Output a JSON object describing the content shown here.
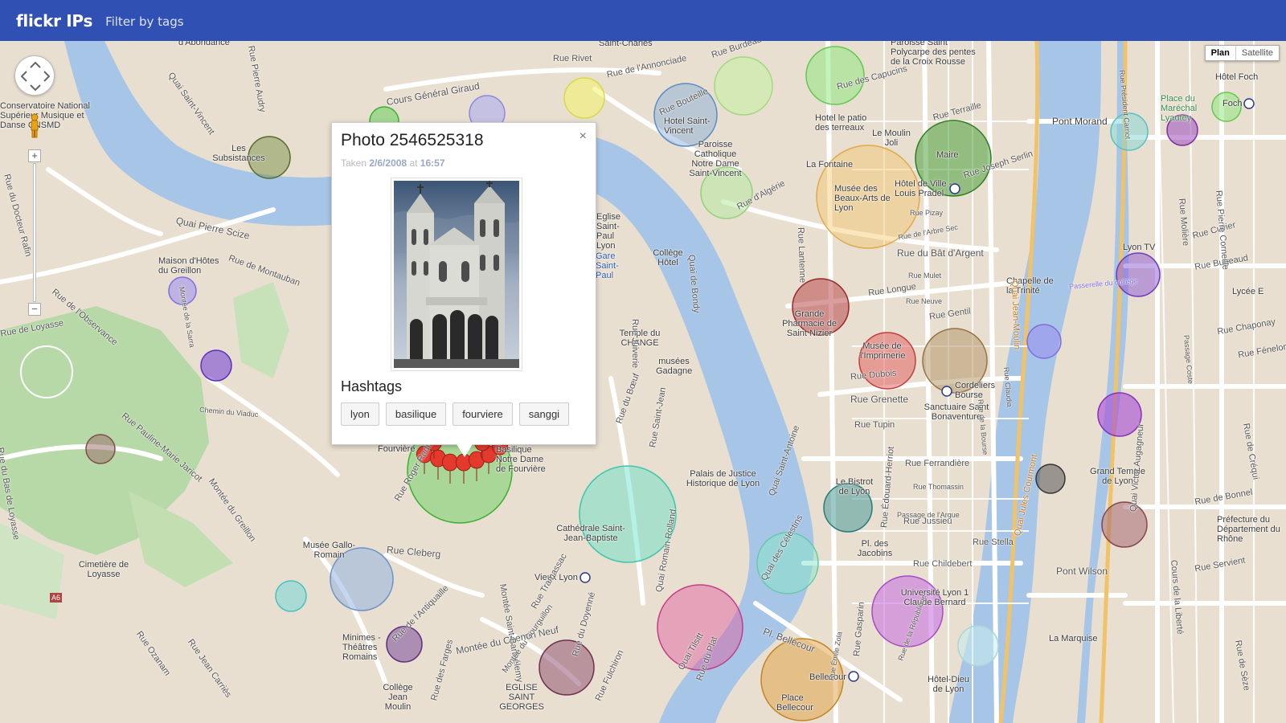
{
  "header": {
    "brand": "flickr IPs",
    "filter_label": "Filter by tags"
  },
  "map_controls": {
    "plan_label": "Plan",
    "satellite_label": "Satellite",
    "zoom_in": "+",
    "zoom_out": "−"
  },
  "popup": {
    "title": "Photo 2546525318",
    "taken_prefix": "Taken",
    "date": "2/6/2008",
    "at": "at",
    "time": "16:57",
    "hashtags_heading": "Hashtags",
    "close": "×",
    "tags": [
      "lyon",
      "basilique",
      "fourviere",
      "sanggi"
    ]
  },
  "labels": [
    "d'Abondance",
    "Saint-Charles",
    "Rue Burdeau",
    "Paroisse Saint Polycarpe des pentes de la Croix Rousse",
    "Rue Rivet",
    "Rue de l'Annonciade",
    "Rue des Capucins",
    "Hôtel Foch",
    "Cours Général Giraud",
    "Rue Bouteille",
    "Conservatoire National Supérieur Musique et Danse CNSMD",
    "Hotel le patio des terreaux",
    "Rue Terraille",
    "Pont Morand",
    "Place du Maréchal Lyautey",
    "Foch",
    "Hotel Saint-Vincent",
    "Paroisse Catholique Notre Dame Saint-Vincent",
    "Le Moulin Joli",
    "Les Subsistances",
    "Quai Saint-Vincent",
    "La Fontaine",
    "Maire",
    "Rue Joseph Serlin",
    "Musée des Beaux-Arts de Lyon",
    "Hôtel de Ville - Louis Pradel",
    "Rue d'Algérie",
    "Quai Pierre Scize",
    "Rue Pizay",
    "Rue de l'Arbre Sec",
    "Eglise Saint-Paul Lyon",
    "Collège Hôtel",
    "Gare Saint-Paul",
    "Maison d'Hôtes du Greillon",
    "Rue du Bât d'Argent",
    "Lyon TV",
    "Rue Bugeaud",
    "Rue de Montauban",
    "Rue Mulet",
    "Chapelle de la Trinité",
    "Rue Longue",
    "Rue Neuve",
    "Rue Gentil",
    "Lycée E",
    "Grande Pharmacie de Saint Nizier",
    "Musée de l'Imprimerie",
    "Temple du CHANGE",
    "musées Gadagne",
    "Rue Dubois",
    "Cordeliers Bourse",
    "Sanctuaire Saint Bonaventure",
    "Rue Grenette",
    "Chemin du Viaduc",
    "Rue Tupin",
    "Rue Ferrandière",
    "Rue Pauline-Marie Jaricot",
    "Fourvière",
    "Basilique Notre Dame de Fourvière",
    "Palais de Justice Historique de Lyon",
    "Le Bistrot de Lyon",
    "Grand Temple de Lyon",
    "Rue Thomassin",
    "Passage de l'Argue",
    "Rue de Bonnel",
    "Préfecture du Département du Rhône",
    "Cathédrale Saint-Jean-Baptiste",
    "Rue Jussieu",
    "Rue Stella",
    "Musée Gallo-Romain",
    "Rue Cleberg",
    "Pl. des Jacobins",
    "Rue Childebert",
    "Pont Wilson",
    "Cimetière de Loyasse",
    "Vieux Lyon",
    "Université Lyon 1 Claude Bernard",
    "Rue Servient",
    "Minimes - Théâtres Romains",
    "Montée du Chemin Neuf",
    "Quai Tilsitt",
    "Pl. Bellecour",
    "La Marquise",
    "Collège Jean Moulin",
    "EGLISE SAINT GEORGES",
    "Bellecour",
    "Hôtel-Dieu de Lyon",
    "Place Bellecour",
    "Quai Jean-Moulin",
    "Quai Jules Courmont",
    "Quai Saint-Antoine",
    "Quai Romain Rolland",
    "Quai de Bondy",
    "Rue de la République",
    "Montée Saint-Barthélemy",
    "Quai des Célestins",
    "Rue Édouard-Herriot",
    "Rue Gasparin",
    "Rue Émile Zola",
    "Rue de la Bourse",
    "Rue Claudia",
    "Rue Président Carnot",
    "Passerelle du collège",
    "Rue Molière",
    "Rue Cuvier",
    "Rue Pierre Corneille",
    "Rue Chaponay",
    "Rue Fénelon",
    "Rue de Sèze",
    "Quai Victor Augagneur",
    "Rue de Créqui",
    "Cours de la Liberté",
    "Passage Coste",
    "Rue Lantenne",
    "Rue Roger Radisson",
    "Rue de l'Antiquaille",
    "Rue du Doyenné",
    "Rue Fulchiron",
    "Montée du Gourguillon",
    "Rue des Farges",
    "Rue Juiverie",
    "Montée de la Sarra",
    "Rue de l'Observance",
    "Rue du Docteur Rafin",
    "Rue de Loyasse",
    "Rue Pierre Audry",
    "Rue du Bœuf",
    "Rue Saint-Jean",
    "A6",
    "Montée du Greillon",
    "Rue Ozanam",
    "Rue du Plat",
    "Rue Tramassac",
    "Rue du Bas de Loyasse",
    "Rue Jean Carriès"
  ]
}
